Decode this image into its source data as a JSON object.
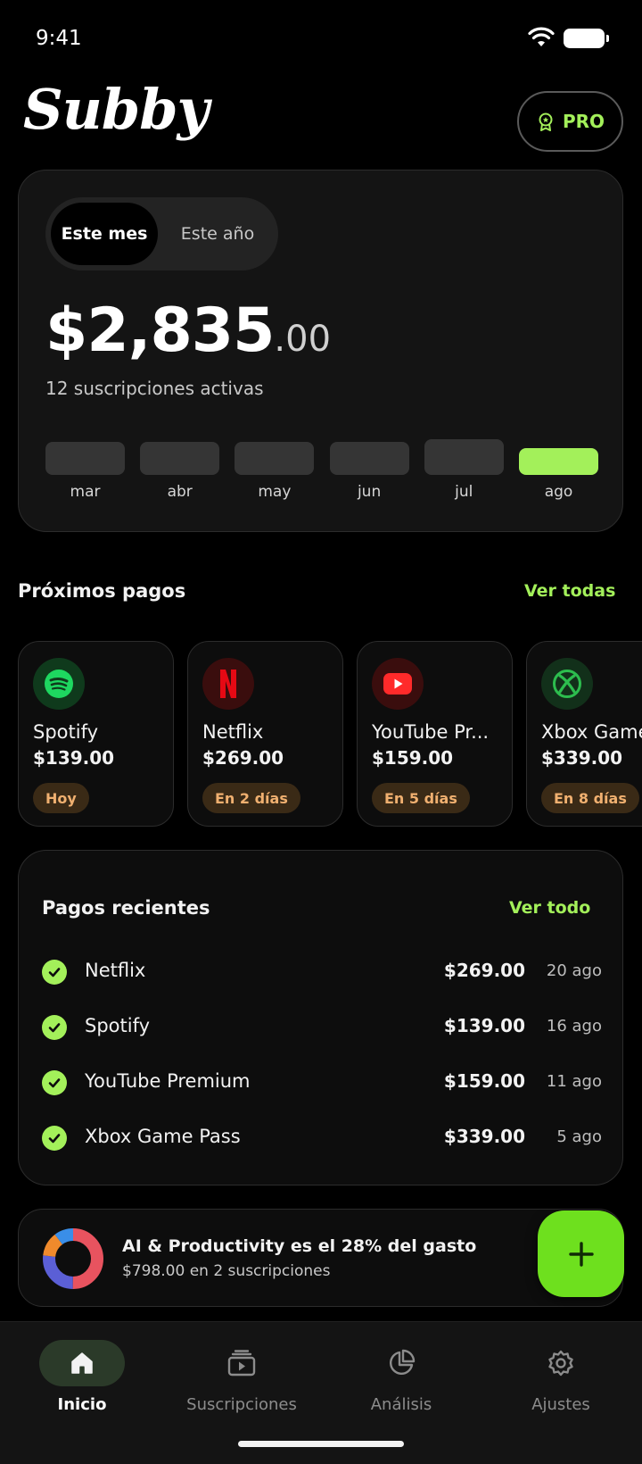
{
  "status_bar": {
    "time": "9:41"
  },
  "header": {
    "logo": "Subby",
    "pro_label": "PRO"
  },
  "summary": {
    "tabs": [
      "Este mes",
      "Este año"
    ],
    "selected_tab": "Este mes",
    "amount_main": "$2,835",
    "amount_cents": ".00",
    "active_subscriptions": "12 suscripciones activas",
    "months": [
      {
        "label": "mar",
        "level": 0.82
      },
      {
        "label": "abr",
        "level": 0.82
      },
      {
        "label": "may",
        "level": 0.82
      },
      {
        "label": "jun",
        "level": 0.82
      },
      {
        "label": "jul",
        "level": 0.88
      },
      {
        "label": "ago",
        "level": 0.64,
        "current": true
      }
    ]
  },
  "upcoming": {
    "title": "Próximos pagos",
    "link": "Ver todas",
    "items": [
      {
        "name": "Spotify",
        "price": "$139.00",
        "badge": "Hoy",
        "icon": "spotify-icon",
        "color": "#1ed760",
        "icon_bg": "#0f3a1c"
      },
      {
        "name": "Netflix",
        "price": "$269.00",
        "badge": "En 2 días",
        "icon": "netflix-icon",
        "color": "#e50914",
        "icon_bg": "#3a0d0d"
      },
      {
        "name": "YouTube Pr...",
        "price": "$159.00",
        "badge": "En 5 días",
        "icon": "youtube-icon",
        "color": "#ff2a2a",
        "icon_bg": "#3a0d0d"
      },
      {
        "name": "Xbox Game",
        "price": "$339.00",
        "badge": "En 8 días",
        "icon": "xbox-icon",
        "color": "#2dbd4e",
        "icon_bg": "#12301a"
      }
    ]
  },
  "recent": {
    "title": "Pagos recientes",
    "link": "Ver todo",
    "items": [
      {
        "name": "Netflix",
        "amount": "$269.00",
        "date": "20 ago"
      },
      {
        "name": "Spotify",
        "amount": "$139.00",
        "date": "16 ago"
      },
      {
        "name": "YouTube Premium",
        "amount": "$159.00",
        "date": "11 ago"
      },
      {
        "name": "Xbox Game Pass",
        "amount": "$339.00",
        "date": "5 ago"
      }
    ]
  },
  "insight": {
    "title": "AI & Productivity es el 28% del gasto",
    "subtitle": "$798.00 en 2 suscripciones",
    "share_percent": 28
  },
  "fab": {
    "icon": "plus-icon"
  },
  "nav": {
    "items": [
      {
        "label": "Inicio",
        "icon": "home-icon",
        "active": true
      },
      {
        "label": "Suscripciones",
        "icon": "subscriptions-icon",
        "active": false
      },
      {
        "label": "Análisis",
        "icon": "analytics-icon",
        "active": false
      },
      {
        "label": "Ajustes",
        "icon": "settings-icon",
        "active": false
      }
    ]
  },
  "colors": {
    "accent": "#a3f05a",
    "fab": "#6ee01e",
    "badge_text": "#f0b070",
    "background": "#000000"
  }
}
